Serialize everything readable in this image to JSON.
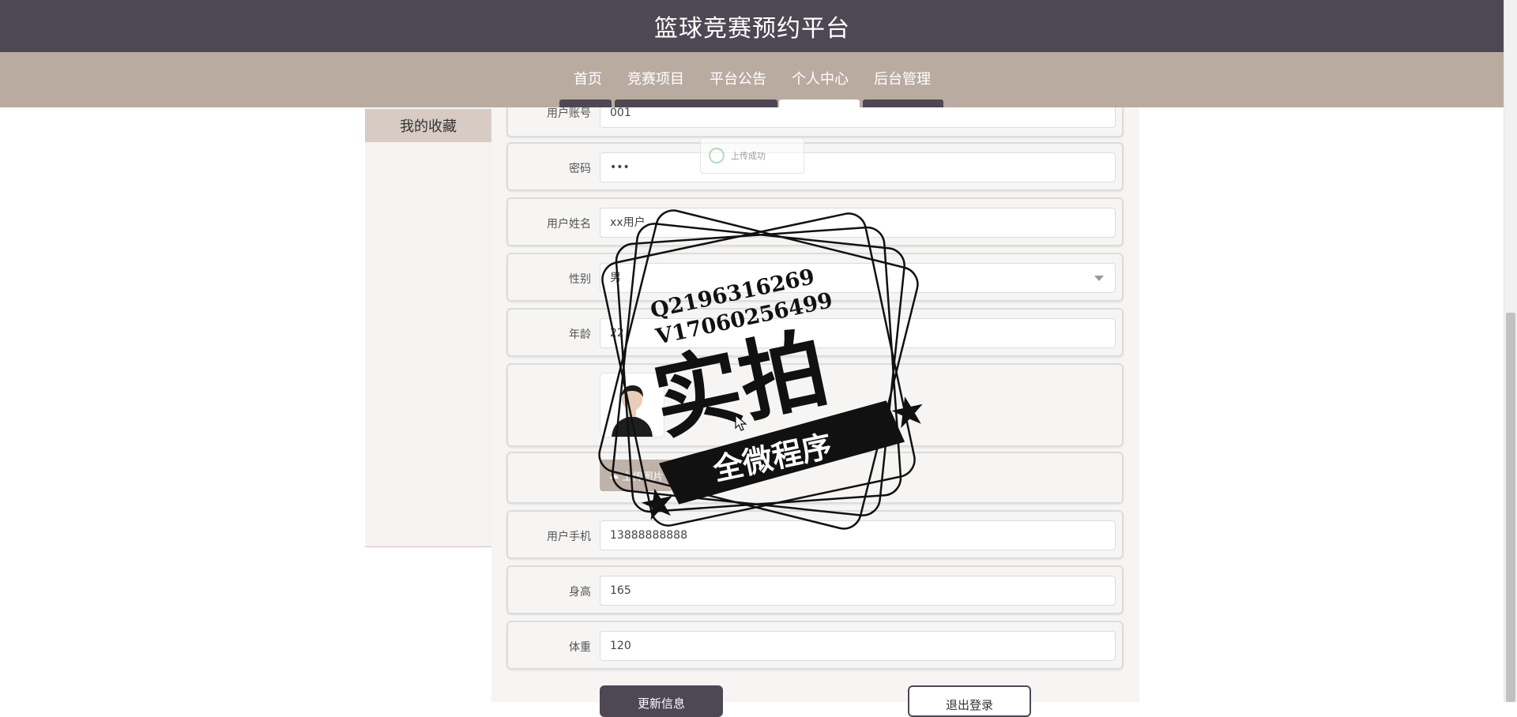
{
  "header": {
    "title": "篮球竞赛预约平台"
  },
  "nav": {
    "items": [
      {
        "label": "首页"
      },
      {
        "label": "竞赛项目"
      },
      {
        "label": "平台公告"
      },
      {
        "label": "个人中心",
        "active": true
      },
      {
        "label": "后台管理"
      }
    ]
  },
  "sidebar": {
    "items": [
      {
        "label": "我的收藏"
      }
    ]
  },
  "form": {
    "account": {
      "label": "用户账号",
      "value": "001"
    },
    "password": {
      "label": "密码",
      "value": "•••"
    },
    "name": {
      "label": "用户姓名",
      "value": "xx用户"
    },
    "gender": {
      "label": "性别",
      "value": "男"
    },
    "age": {
      "label": "年龄",
      "value": "22"
    },
    "upload_label": "上传图片",
    "phone": {
      "label": "用户手机",
      "value": "13888888888"
    },
    "height": {
      "label": "身高",
      "value": "165"
    },
    "weight": {
      "label": "体重",
      "value": "120"
    }
  },
  "toast": {
    "text": "上传成功"
  },
  "actions": {
    "update_label": "更新信息",
    "logout_label": "退出登录"
  },
  "stamp": {
    "line1": "Q2196316269",
    "line2": "V17060256499",
    "main": "实拍",
    "banner": "全微程序"
  },
  "colors": {
    "header_bg": "#4e4754",
    "nav_bg": "#baaba0",
    "sidebar_active": "#d7cbc3",
    "panel_bg": "#f6f5f4"
  }
}
